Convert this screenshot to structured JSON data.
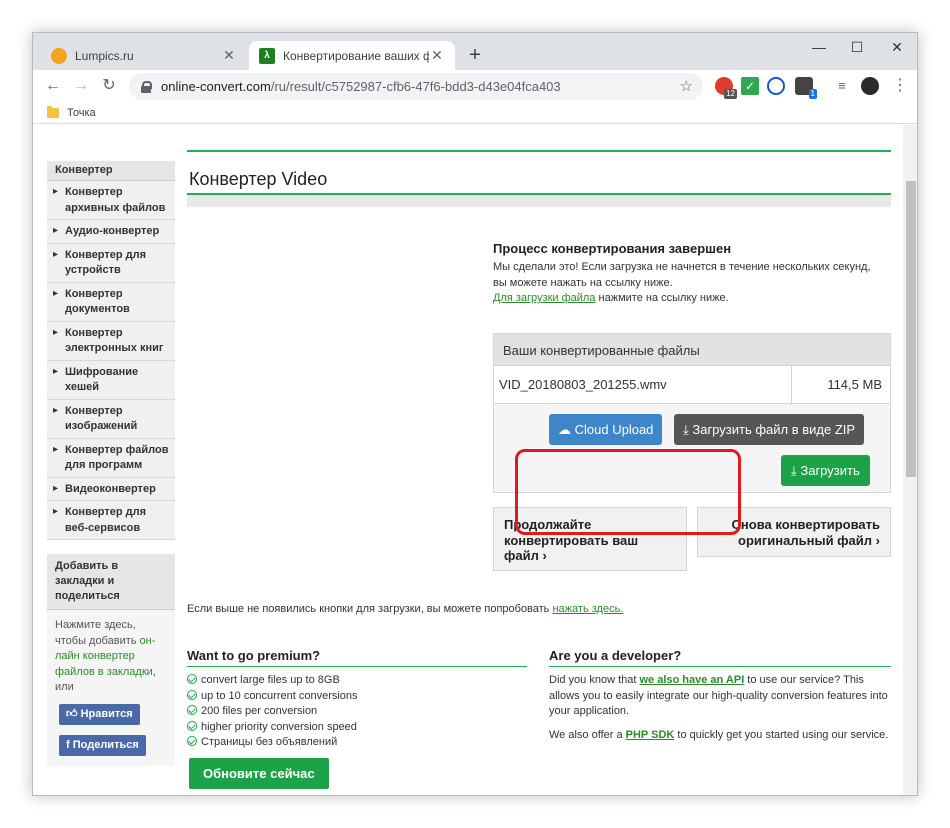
{
  "browser": {
    "tabs": [
      {
        "title": "Lumpics.ru",
        "active": false
      },
      {
        "title": "Конвертирование ваших файл",
        "active": true
      }
    ],
    "url_host": "online-convert.com",
    "url_path": "/ru/result/c5752987-cfb6-47f6-bdd3-d43e04fca403",
    "bookmark": "Точка",
    "ext_badges": {
      "mail": "12",
      "box": "1"
    }
  },
  "sidebar": {
    "header": "Конвертер",
    "items": [
      "Конвертер архивных файлов",
      "Аудио-конвертер",
      "Конвертер для устройств",
      "Конвертер документов",
      "Конвертер электронных книг",
      "Шифрование хешей",
      "Конвертер изображений",
      "Конвертер файлов для программ",
      "Видеоконвертер",
      "Конвертер для веб-сервисов"
    ],
    "bookmark_box": {
      "title": "Добавить в закладки и поделиться",
      "text_1": "Нажмите здесь, чтобы добавить ",
      "text_link": "он-лайн конвертер файлов в закладки",
      "text_2": ", или",
      "like": "Нравится",
      "share": "Поделиться"
    }
  },
  "main": {
    "title": "Конвертер Video",
    "done_title": "Процесс конвертирования завершен",
    "done_text": "Мы сделали это! Если загрузка не начнется в течение нескольких секунд, вы можете нажать на ссылку ниже.",
    "done_link": "Для загрузки файла",
    "done_link_after": " нажмите на ссылку ниже.",
    "files_header": "Ваши конвертированные файлы",
    "file_name": "VID_20180803_201255.wmv",
    "file_size": "114,5 MB",
    "btn_cloud": "Cloud Upload",
    "btn_zip": "Загрузить файл в виде ZIP",
    "btn_download": "Загрузить",
    "card_continue": "Продолжайте конвертировать ваш файл",
    "card_again": "Снова конвертировать оригинальный файл",
    "try_text": "Если выше не появились кнопки для загрузки, вы можете попробовать ",
    "try_link": "нажать здесь.",
    "premium_title": "Want to go premium?",
    "premium_items": [
      "convert large files up to 8GB",
      "up to 10 concurrent conversions",
      "200 files per conversion",
      "higher priority conversion speed",
      "Страницы без объявлений"
    ],
    "upgrade_button": "Обновите сейчас",
    "dev_title": "Are you a developer?",
    "dev_p1_a": "Did you know that ",
    "dev_p1_link": "we also have an API",
    "dev_p1_b": " to use our service? This allows you to easily integrate our high-quality conversion features into your application.",
    "dev_p2_a": "We also offer a ",
    "dev_p2_link": "PHP SDK",
    "dev_p2_b": " to quickly get you started using our service."
  }
}
